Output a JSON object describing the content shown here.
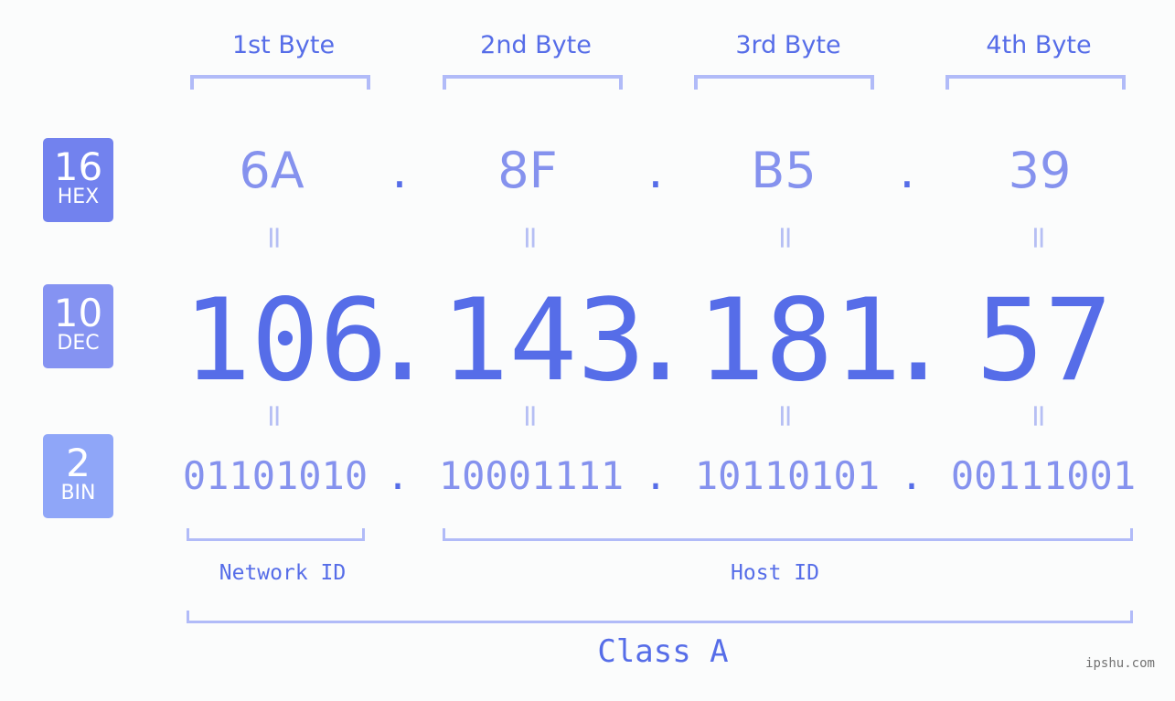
{
  "badges": [
    {
      "base": "16",
      "label": "HEX",
      "color": "#7282ee"
    },
    {
      "base": "10",
      "label": "DEC",
      "color": "#8593f2"
    },
    {
      "base": "2",
      "label": "BIN",
      "color": "#8fa6f8"
    }
  ],
  "bytes": [
    {
      "header": "1st Byte",
      "hex": "6A",
      "dec": "106",
      "bin": "01101010"
    },
    {
      "header": "2nd Byte",
      "hex": "8F",
      "dec": "143",
      "bin": "10001111"
    },
    {
      "header": "3rd Byte",
      "hex": "B5",
      "dec": "181",
      "bin": "10110101"
    },
    {
      "header": "4th Byte",
      "hex": "39",
      "dec": "57",
      "bin": "00111001"
    }
  ],
  "separator": ".",
  "equals_symbol": "=",
  "network_id_label": "Network ID",
  "host_id_label": "Host ID",
  "class_label": "Class A",
  "watermark": "ipshu.com",
  "colors": {
    "primary": "#566de8",
    "secondary": "#8592ee",
    "bracket": "#b1bbf8",
    "equals": "#b6bff4",
    "background": "#fbfcfc"
  }
}
